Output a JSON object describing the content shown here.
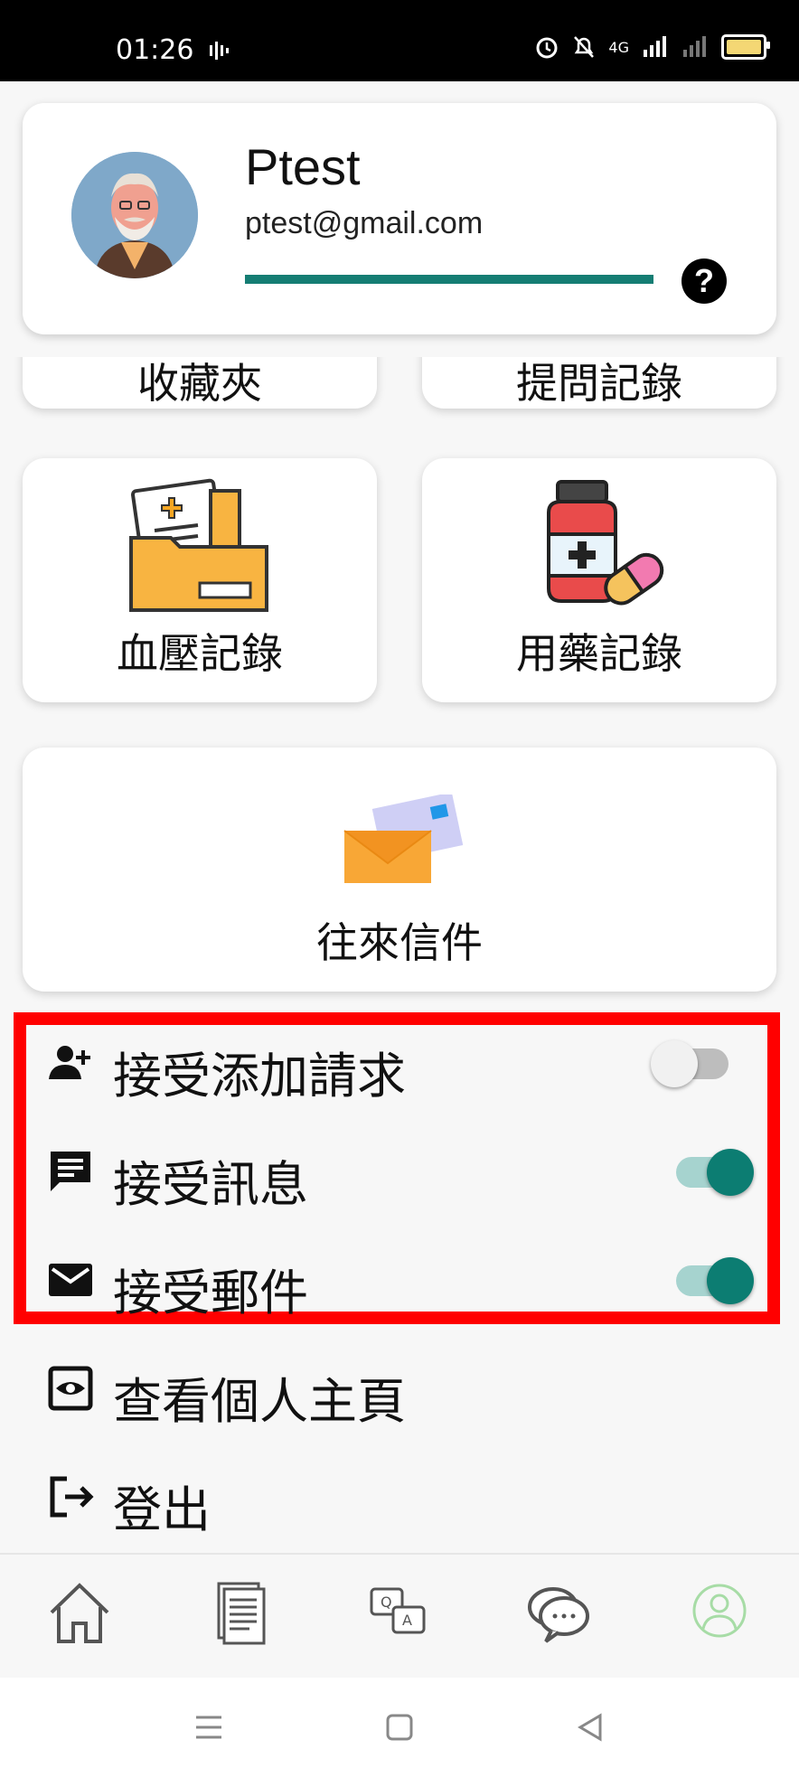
{
  "status_bar": {
    "time": "01:26",
    "network": "4G"
  },
  "profile": {
    "name": "Ptest",
    "email": "ptest@gmail.com",
    "progress": 1.0,
    "help_label": "?"
  },
  "tiles": {
    "favorites": "收藏夾",
    "questions": "提問記錄",
    "blood_pressure": "血壓記錄",
    "medication": "用藥記錄",
    "mail": "往來信件"
  },
  "settings": {
    "accept_add_request": {
      "label": "接受添加請求",
      "enabled": false
    },
    "accept_messages": {
      "label": "接受訊息",
      "enabled": true
    },
    "accept_mail": {
      "label": "接受郵件",
      "enabled": true
    }
  },
  "actions": {
    "view_profile": "查看個人主頁",
    "logout": "登出"
  },
  "colors": {
    "accent": "#0c7d72",
    "highlight_border": "#ff0000"
  },
  "bottom_nav": [
    {
      "name": "home-icon"
    },
    {
      "name": "document-icon"
    },
    {
      "name": "qa-icon"
    },
    {
      "name": "chat-icon"
    },
    {
      "name": "profile-icon",
      "active": true
    }
  ]
}
